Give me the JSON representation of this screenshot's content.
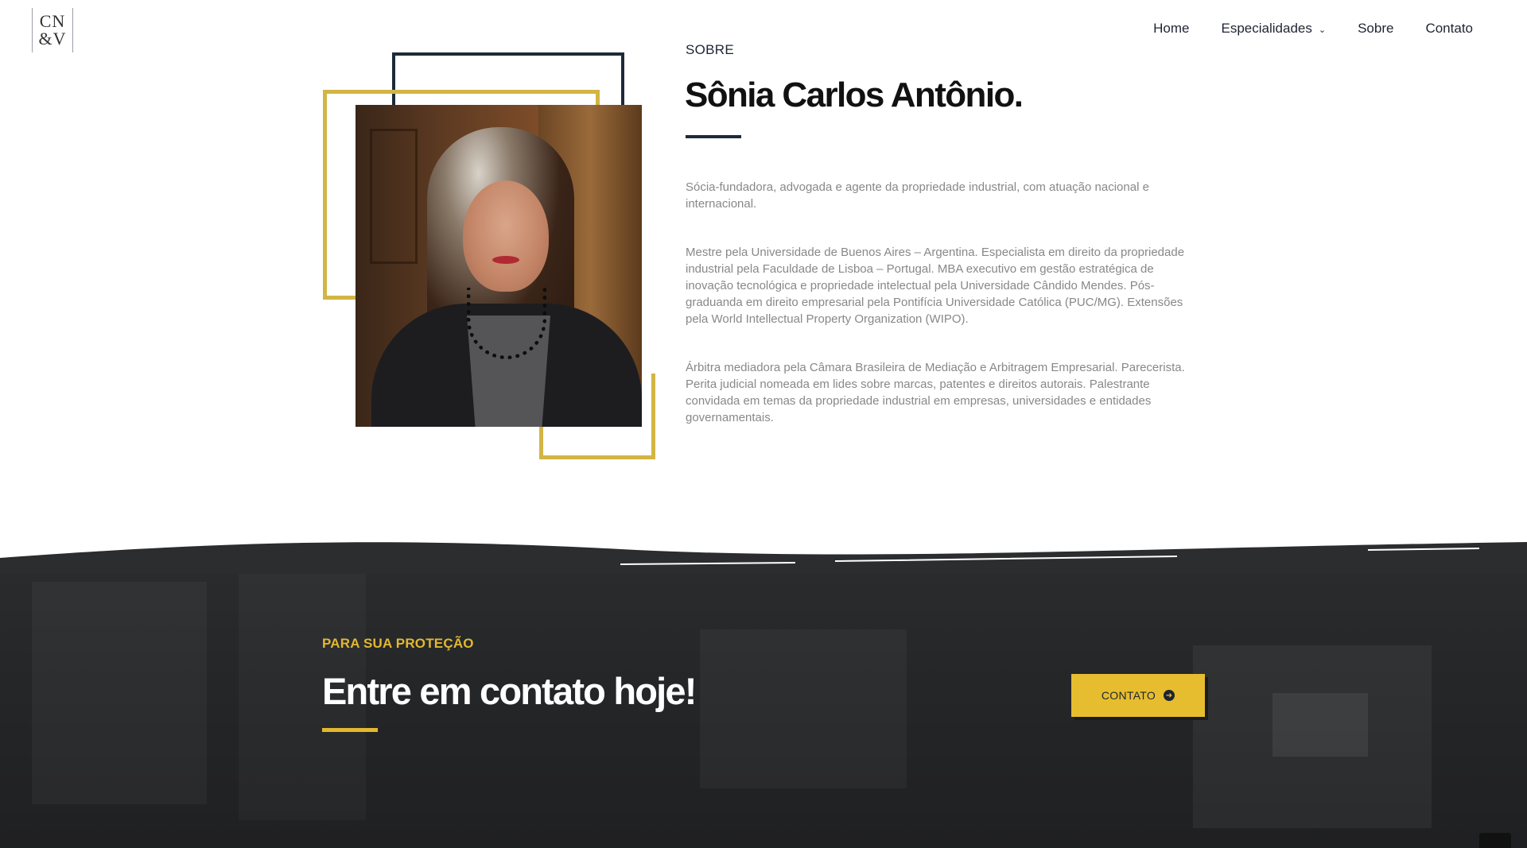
{
  "brand": {
    "logo_line1": "CN",
    "logo_line2": "&V"
  },
  "nav": {
    "items": [
      {
        "label": "Home"
      },
      {
        "label": "Especialidades",
        "has_dropdown": true
      },
      {
        "label": "Sobre"
      },
      {
        "label": "Contato"
      }
    ]
  },
  "about": {
    "eyebrow": "SOBRE",
    "name": "Sônia Carlos Antônio.",
    "paragraphs": [
      "Sócia-fundadora, advogada e agente da propriedade industrial, com atuação nacional e internacional.",
      "Mestre pela Universidade de Buenos Aires – Argentina. Especialista em direito da propriedade industrial pela Faculdade de Lisboa – Portugal. MBA executivo em gestão estratégica de inovação tecnológica e propriedade intelectual pela Universidade Cândido Mendes. Pós-graduanda em direito empresarial pela Pontifícia Universidade Católica (PUC/MG). Extensões pela World Intellectual Property Organization (WIPO).",
      "Árbitra mediadora pela Câmara Brasileira de Mediação e Arbitragem Empresarial. Parecerista. Perita judicial nomeada em lides sobre marcas, patentes e direitos autorais. Palestrante convidada em temas da propriedade industrial em empresas, universidades e entidades governamentais."
    ]
  },
  "cta": {
    "eyebrow": "PARA SUA PROTEÇÃO",
    "title": "Entre em contato hoje!",
    "button_label": "CONTATO",
    "button_icon": "arrow-circle-right-icon"
  },
  "colors": {
    "gold": "#d2b544",
    "navy": "#1e2a3a",
    "dark_band": "#26272a",
    "button_yellow": "#e6bd2f"
  }
}
